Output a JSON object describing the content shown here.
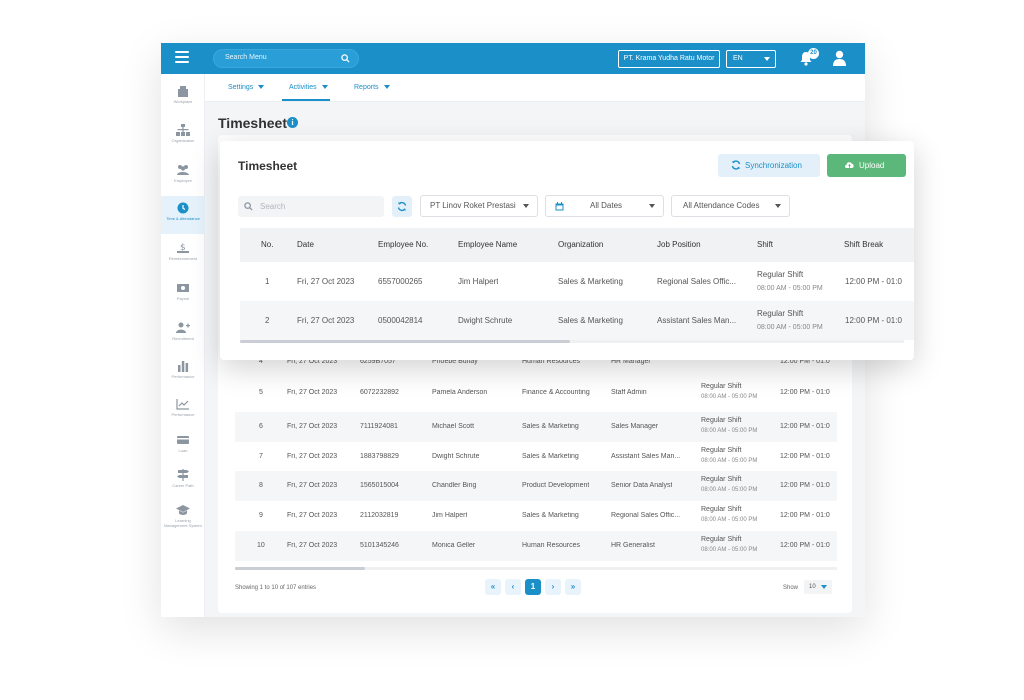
{
  "topbar": {
    "search_placeholder": "Search Menu",
    "company": "PT. Krama Yudha Ratu Motor",
    "language": "EN",
    "notification_count": "20"
  },
  "sidebar": {
    "items": [
      {
        "label": "Workplace",
        "icon": "building-icon"
      },
      {
        "label": "Organization",
        "icon": "org-chart-icon"
      },
      {
        "label": "Employee",
        "icon": "people-icon"
      },
      {
        "label": "Time & Attendance",
        "icon": "clock-icon"
      },
      {
        "label": "Reimbursement",
        "icon": "dollar-hand-icon"
      },
      {
        "label": "Payroll",
        "icon": "money-icon"
      },
      {
        "label": "Recruitment",
        "icon": "add-user-icon"
      },
      {
        "label": "Performance",
        "icon": "bar-chart-icon"
      },
      {
        "label": "Performance",
        "icon": "trend-icon"
      },
      {
        "label": "Loan",
        "icon": "card-icon"
      },
      {
        "label": "Career Path",
        "icon": "signpost-icon"
      },
      {
        "label": "Learning Management System",
        "icon": "graduation-cap-icon"
      }
    ]
  },
  "subnav": {
    "tabs": [
      {
        "label": "Settings"
      },
      {
        "label": "Activities"
      },
      {
        "label": "Reports"
      }
    ]
  },
  "page": {
    "title": "Timesheet"
  },
  "back_table": {
    "rows": [
      {
        "no": "4",
        "date": "Fri, 27 Oct 2023",
        "emp_no": "6259B7057",
        "name": "Phoebe Buffay",
        "org": "Human Resources",
        "position": "HR Manager",
        "shift": "",
        "hours": "",
        "brk": "12:00 PM - 01:0"
      },
      {
        "no": "5",
        "date": "Fri, 27 Oct 2023",
        "emp_no": "6072232892",
        "name": "Pamela Anderson",
        "org": "Finance & Accounting",
        "position": "Staff Admin",
        "shift": "Regular Shift",
        "hours": "08:00 AM - 05:00 PM",
        "brk": "12:00 PM - 01:0"
      },
      {
        "no": "6",
        "date": "Fri, 27 Oct 2023",
        "emp_no": "7111924081",
        "name": "Michael Scott",
        "org": "Sales & Marketing",
        "position": "Sales Manager",
        "shift": "Regular Shift",
        "hours": "08:00 AM - 05:00 PM",
        "brk": "12:00 PM - 01:0"
      },
      {
        "no": "7",
        "date": "Fri, 27 Oct 2023",
        "emp_no": "1883798829",
        "name": "Dwight Schrute",
        "org": "Sales & Marketing",
        "position": "Assistant Sales Man...",
        "shift": "Regular Shift",
        "hours": "08:00 AM - 05:00 PM",
        "brk": "12:00 PM - 01:0"
      },
      {
        "no": "8",
        "date": "Fri, 27 Oct 2023",
        "emp_no": "1565015004",
        "name": "Chandler Bing",
        "org": "Product Development",
        "position": "Senior Data Analyst",
        "shift": "Regular Shift",
        "hours": "08:00 AM - 05:00 PM",
        "brk": "12:00 PM - 01:0"
      },
      {
        "no": "9",
        "date": "Fri, 27 Oct 2023",
        "emp_no": "2112032819",
        "name": "Jim Halpert",
        "org": "Sales & Marketing",
        "position": "Regional Sales Offic...",
        "shift": "Regular Shift",
        "hours": "08:00 AM - 05:00 PM",
        "brk": "12:00 PM - 01:0"
      },
      {
        "no": "10",
        "date": "Fri, 27 Oct 2023",
        "emp_no": "5101345246",
        "name": "Monica Geller",
        "org": "Human Resources",
        "position": "HR Generalist",
        "shift": "Regular Shift",
        "hours": "08:00 AM - 05:00 PM",
        "brk": "12:00 PM - 01:0"
      }
    ],
    "entries_text": "Showing 1 to 10 of 107 entries",
    "pager": {
      "first": "«",
      "prev": "‹",
      "current": "1",
      "next": "›",
      "last": "»"
    },
    "show_label": "Show",
    "show_value": "10"
  },
  "front_card": {
    "title": "Timesheet",
    "sync_label": "Synchronization",
    "upload_label": "Upload",
    "search_placeholder": "Search",
    "company_filter": "PT Linov Roket Prestasi",
    "date_filter": "All Dates",
    "code_filter": "All Attendance Codes",
    "columns": [
      "No.",
      "Date",
      "Employee No.",
      "Employee Name",
      "Organization",
      "Job Position",
      "Shift",
      "Shift Break"
    ],
    "rows": [
      {
        "no": "1",
        "date": "Fri, 27 Oct 2023",
        "emp_no": "6557000265",
        "name": "Jim Halpert",
        "org": "Sales & Marketing",
        "position": "Regional Sales Offic...",
        "shift": "Regular Shift",
        "hours": "08:00 AM - 05:00 PM",
        "brk": "12:00 PM - 01:0"
      },
      {
        "no": "2",
        "date": "Fri, 27 Oct 2023",
        "emp_no": "0500042814",
        "name": "Dwight Schrute",
        "org": "Sales & Marketing",
        "position": "Assistant Sales Man...",
        "shift": "Regular Shift",
        "hours": "08:00 AM - 05:00 PM",
        "brk": "12:00 PM - 01:0"
      }
    ]
  },
  "colors": {
    "primary": "#1b8fc8",
    "upload": "#5cb87a"
  }
}
